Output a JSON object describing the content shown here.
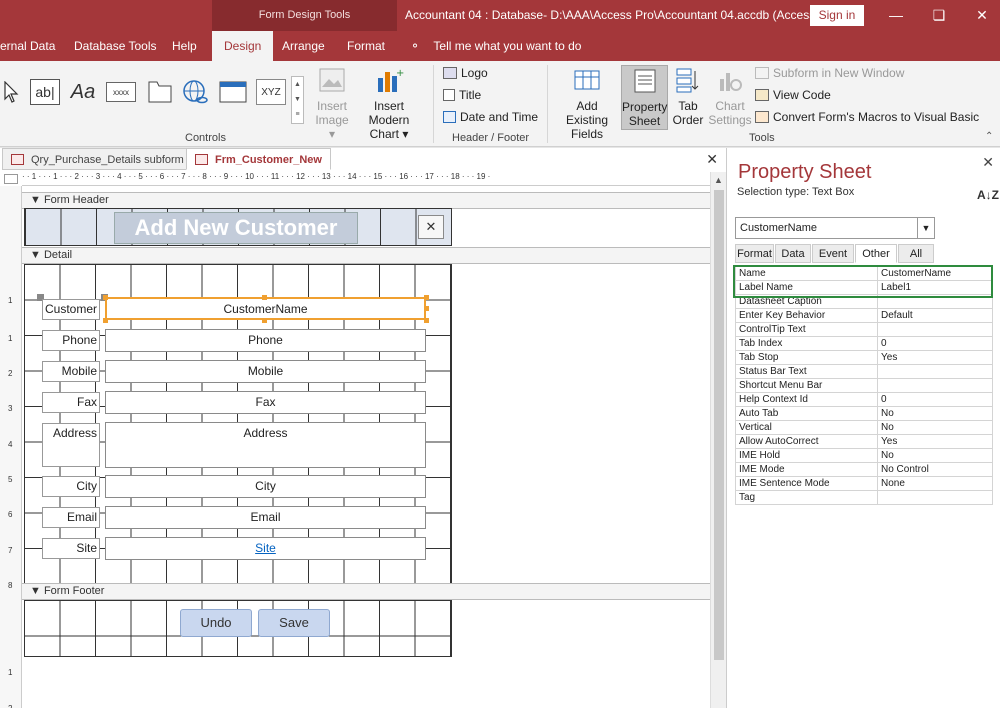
{
  "titlebar": {
    "context_tool": "Form Design Tools",
    "title": "Accountant 04 : Database- D:\\AAA\\Access Pro\\Accountant 04.accdb (Access...",
    "signin": "Sign in",
    "min_icon": "minimize-icon",
    "restore_icon": "restore-icon",
    "close_icon": "close-icon"
  },
  "menu": {
    "tabs": [
      "ernal Data",
      "Database Tools",
      "Help",
      "Design",
      "Arrange",
      "Format"
    ],
    "active": "Design",
    "tell_me": "Tell me what you want to do"
  },
  "ribbon": {
    "controls_label": "Controls",
    "insert_image": "Insert\nImage ▾",
    "insert_image_l1": "Insert",
    "insert_image_l2": "Image ▾",
    "insert_chart_l1": "Insert Modern",
    "insert_chart_l2": "Chart ▾",
    "logo": "Logo",
    "title": "Title",
    "date_time": "Date and Time",
    "header_footer_label": "Header / Footer",
    "add_fields_l1": "Add Existing",
    "add_fields_l2": "Fields",
    "property_sheet_l1": "Property",
    "property_sheet_l2": "Sheet",
    "tab_order_l1": "Tab",
    "tab_order_l2": "Order",
    "chart_settings_l1": "Chart",
    "chart_settings_l2": "Settings",
    "subform": "Subform in New Window",
    "view_code": "View Code",
    "convert_macros": "Convert Form's Macros to Visual Basic",
    "tools_label": "Tools",
    "control_glyphs": {
      "textbox": "ab|",
      "label": "Aa",
      "button": "xxxx",
      "combo": "XYZ"
    }
  },
  "doc": {
    "tabs": [
      {
        "label": "Qry_Purchase_Details subform",
        "active": false
      },
      {
        "label": "Frm_Customer_New",
        "active": true
      }
    ],
    "ruler": "· · 1 · · · 1 · · · 2 · · · 3 · · · 4 · · · 5 · · · 6 · · · 7 · · · 8 · · · 9 · · · 10 · · · 11 · · · 12 · · · 13 · · · 14 · · · 15 · · · 16 · · · 17 · · · 18 · · · 19 ·",
    "vruler": [
      "1",
      "1",
      "2",
      "3",
      "4",
      "5",
      "6",
      "7",
      "8",
      "1",
      "2"
    ],
    "sections": {
      "header": "Form Header",
      "detail": "Detail",
      "footer": "Form Footer"
    },
    "form_title": "Add New Customer",
    "close_glyph": "✕",
    "fields": [
      {
        "label": "Customer",
        "value": "CustomerName"
      },
      {
        "label": "Phone",
        "value": "Phone"
      },
      {
        "label": "Mobile",
        "value": "Mobile"
      },
      {
        "label": "Fax",
        "value": "Fax"
      },
      {
        "label": "Address",
        "value": "Address"
      },
      {
        "label": "City",
        "value": "City"
      },
      {
        "label": "Email",
        "value": "Email"
      },
      {
        "label": "Site",
        "value": "Site"
      }
    ],
    "buttons": {
      "undo": "Undo",
      "save": "Save"
    }
  },
  "property_sheet": {
    "title": "Property Sheet",
    "selection_type": "Selection type:  Text Box",
    "sort_glyph": "A↓Z",
    "selected_object": "CustomerName",
    "tabs": [
      "Format",
      "Data",
      "Event",
      "Other",
      "All"
    ],
    "active_tab": "Other",
    "rows": [
      {
        "key": "Name",
        "value": "CustomerName"
      },
      {
        "key": "Label Name",
        "value": "Label1"
      },
      {
        "key": "Datasheet Caption",
        "value": ""
      },
      {
        "key": "Enter Key Behavior",
        "value": "Default"
      },
      {
        "key": "ControlTip Text",
        "value": ""
      },
      {
        "key": "Tab Index",
        "value": "0"
      },
      {
        "key": "Tab Stop",
        "value": "Yes"
      },
      {
        "key": "Status Bar Text",
        "value": ""
      },
      {
        "key": "Shortcut Menu Bar",
        "value": ""
      },
      {
        "key": "Help Context Id",
        "value": "0"
      },
      {
        "key": "Auto Tab",
        "value": "No"
      },
      {
        "key": "Vertical",
        "value": "No"
      },
      {
        "key": "Allow AutoCorrect",
        "value": "Yes"
      },
      {
        "key": "IME Hold",
        "value": "No"
      },
      {
        "key": "IME Mode",
        "value": "No Control"
      },
      {
        "key": "IME Sentence Mode",
        "value": "None"
      },
      {
        "key": "Tag",
        "value": ""
      }
    ],
    "highlight_color": "#2e8b3e"
  },
  "colors": {
    "brand": "#a4373a",
    "selection": "#f0a030"
  }
}
